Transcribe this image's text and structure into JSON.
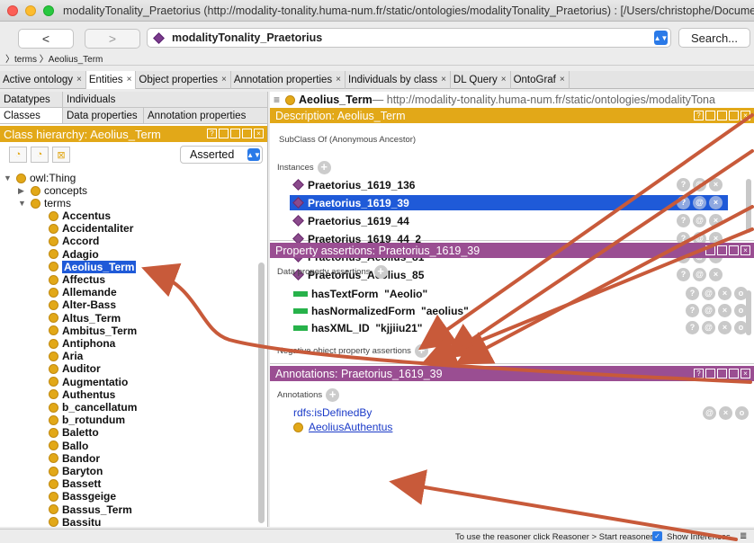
{
  "window": {
    "title": "modalityTonality_Praetorius (http://modality-tonality.huma-num.fr/static/ontologies/modalityTonality_Praetorius) : [/Users/christophe/Documents/..."
  },
  "toolbar": {
    "back": "<",
    "forward": ">",
    "ontology": "modalityTonality_Praetorius",
    "search": "Search..."
  },
  "breadcrumb": {
    "text": "〉terms 〉Aeolius_Term"
  },
  "tabs": [
    {
      "label": "Active ontology"
    },
    {
      "label": "Entities"
    },
    {
      "label": "Object properties"
    },
    {
      "label": "Annotation properties"
    },
    {
      "label": "Individuals by class"
    },
    {
      "label": "DL Query"
    },
    {
      "label": "OntoGraf"
    }
  ],
  "tab_close": "×",
  "left": {
    "subtabs_top": [
      "Datatypes",
      "Individuals"
    ],
    "subtabs_bottom": [
      "Classes",
      "Data properties",
      "Annotation properties"
    ],
    "header": "Class hierarchy: Aeolius_Term",
    "asserted": "Asserted",
    "tree_root": "owl:Thing",
    "tree_concepts": "concepts",
    "tree_terms": "terms",
    "terms": [
      "Accentus",
      "Accidentaliter",
      "Accord",
      "Adagio",
      "Aeolius_Term",
      "Affectus",
      "Allemande",
      "Alter-Bass",
      "Altus_Term",
      "Ambitus_Term",
      "Antiphona",
      "Aria",
      "Auditor",
      "Augmentatio",
      "Authentus",
      "b_cancellatum",
      "b_rotundum",
      "Baletto",
      "Ballo",
      "Bandor",
      "Baryton",
      "Bassett",
      "Bassgeige",
      "Bassus_Term",
      "Bassitu"
    ]
  },
  "right": {
    "entity_name": "Aeolius_Term",
    "entity_url": " — http://modality-tonality.huma-num.fr/static/ontologies/modalityTona",
    "desc_header": "Description: Aeolius_Term",
    "subclass_label": "SubClass Of (Anonymous Ancestor)",
    "instances_label": "Instances",
    "instances": [
      "Praetorius_1619_136",
      "Praetorius_1619_39",
      "Praetorius_1619_44",
      "Praetorius_1619_44_2",
      "Praetorius_Aeolius_81",
      "Praetorius_Aeolius_85"
    ],
    "prop_header": "Property assertions: Praetorius_1619_39",
    "data_prop_label": "Data property assertions",
    "props": [
      {
        "name": "hasTextForm",
        "value": "\"Aeolio\""
      },
      {
        "name": "hasNormalizedForm",
        "value": "\"aeolius\""
      },
      {
        "name": "hasXML_ID",
        "value": "\"kjjiiu21\""
      }
    ],
    "neg_obj_label": "Negative object property assertions",
    "ann_header": "Annotations: Praetorius_1619_39",
    "annotations_label": "Annotations",
    "ann_property": "rdfs:isDefinedBy",
    "ann_value": "AeoliusAuthentus"
  },
  "status": {
    "reasoner_text": "To use the reasoner click Reasoner > Start reasoner",
    "show_inferences": "Show Inferences"
  },
  "icons": {
    "btn_help": "?",
    "btn_at": "@",
    "btn_x": "×",
    "btn_o": "o"
  },
  "colors": {
    "accent_orange": "#e2a818",
    "accent_purple": "#9a4e92",
    "selection": "#1f5ad8",
    "arrow": "#c85a3a"
  }
}
